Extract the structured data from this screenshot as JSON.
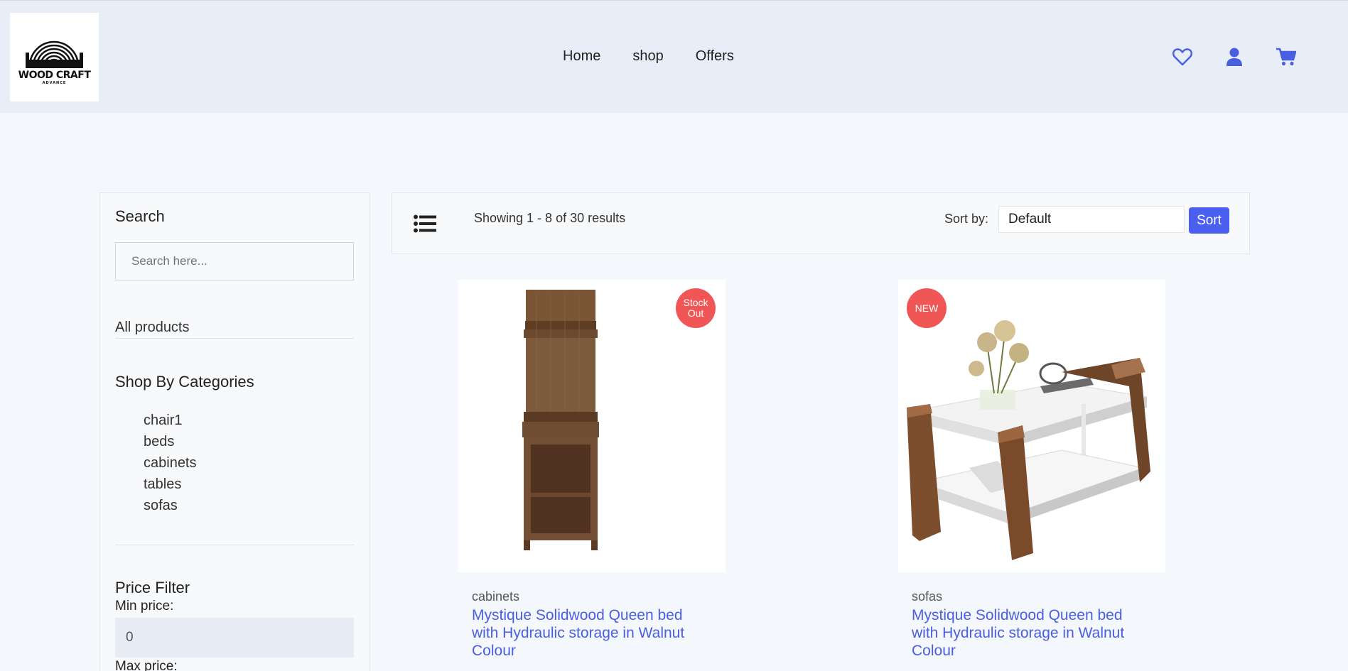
{
  "header": {
    "logo_text": "WOOD CRAFT",
    "logo_subtext": "ADVANCE",
    "nav": [
      "Home",
      "shop",
      "Offers"
    ],
    "icons": [
      "heart-icon",
      "user-icon",
      "cart-icon"
    ],
    "accent": "#4a5ee0"
  },
  "sidebar": {
    "search_heading": "Search",
    "search_placeholder": "Search here...",
    "all_products": "All products",
    "categories_heading": "Shop By Categories",
    "categories": [
      "chair1",
      "beds",
      "cabinets",
      "tables",
      "sofas"
    ],
    "price_heading": "Price Filter",
    "min_label": "Min price:",
    "min_value": "0",
    "max_label": "Max price:"
  },
  "toolbar": {
    "results_text": "Showing 1 - 8 of 30 results",
    "sort_label": "Sort by:",
    "sort_selected": "Default",
    "sort_button": "Sort"
  },
  "products": [
    {
      "badge": "Stock Out",
      "category": "cabinets",
      "title": "Mystique Solidwood Queen bed with Hydraulic storage in Walnut Colour"
    },
    {
      "badge": "NEW",
      "category": "sofas",
      "title": "Mystique Solidwood Queen bed with Hydraulic storage in Walnut Colour"
    }
  ],
  "colors": {
    "header_bg": "#e8eef7",
    "page_bg": "#f4f7fc",
    "badge": "#f05656",
    "sort_button": "#4a5ff0"
  }
}
